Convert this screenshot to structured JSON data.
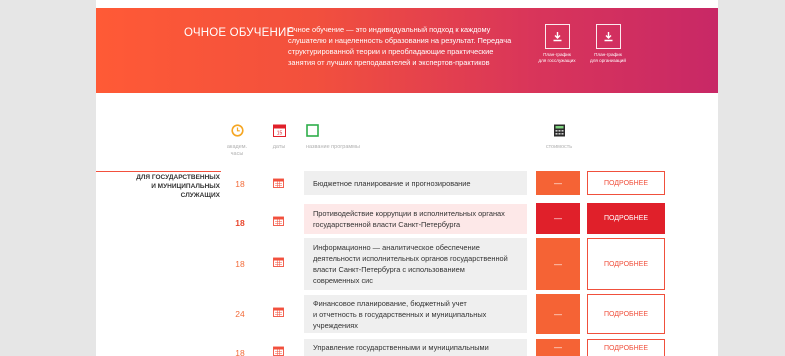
{
  "banner": {
    "title": "ОЧНОЕ ОБУЧЕНИЕ",
    "description": "Очное обучение — это индивидуальный подход к каждому слушателю и нацеленность образования на результат. Передача структурированной теории и преобладающие практические занятия от лучших преподавателей и экспертов-практиков",
    "downloads": [
      {
        "line1": "План-график",
        "line2": "для госслужащих"
      },
      {
        "line1": "План-график",
        "line2": "для организаций"
      }
    ]
  },
  "columns": {
    "hours_line1": "академ.",
    "hours_line2": "часы",
    "dates": "даты",
    "program": "название программы",
    "cost": "стоимость",
    "calendar_number": "15"
  },
  "category": {
    "line1": "ДЛЯ ГОСУДАРСТВЕННЫХ",
    "line2": "И МУНИЦИПАЛЬНЫХ",
    "line3": "СЛУЖАЩИХ"
  },
  "rows": [
    {
      "hours": "18",
      "title": "Бюджетное планирование и прогнозирование",
      "price": "—",
      "more": "ПОДРОБНЕЕ"
    },
    {
      "hours": "18",
      "title_line1": "Противодействие коррупции в исполнительных органах",
      "title_line2": "государственной власти Санкт-Петербурга",
      "price": "—",
      "more": "ПОДРОБНЕЕ"
    },
    {
      "hours": "18",
      "title_line1": "Информационно — аналитическое обеспечение",
      "title_line2": "деятельности исполнительных органов государственной",
      "title_line3": "власти Санкт-Петербурга с использованием",
      "title_line4": "современных сис",
      "price": "—",
      "more": "ПОДРОБНЕЕ"
    },
    {
      "hours": "24",
      "title_line1": "Финансовое планирование, бюджетный учет",
      "title_line2": "и отчетность в государственных и муниципальных",
      "title_line3": "учреждениях",
      "price": "—",
      "more": "ПОДРОБНЕЕ"
    },
    {
      "hours": "18",
      "title_line1": "Управление государственными и муниципальными",
      "price": "—",
      "more": "ПОДРОБНЕЕ"
    }
  ],
  "colors": {
    "accent": "#f2503d",
    "price_bg": "#f56335",
    "active": "#e0202a"
  },
  "icons": {
    "hours": "clock-icon",
    "dates": "calendar-icon",
    "program": "book-icon",
    "cost": "calculator-icon",
    "download": "download-icon"
  }
}
